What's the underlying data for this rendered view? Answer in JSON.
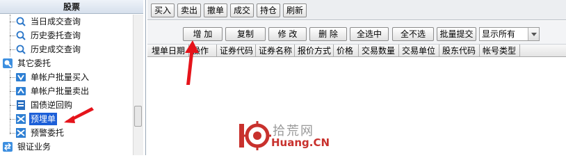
{
  "left_panel": {
    "header": "股票",
    "tree": [
      {
        "label": "当日成交查询",
        "icon": "search-doc-icon",
        "level": 2
      },
      {
        "label": "历史委托查询",
        "icon": "search-doc-icon",
        "level": 2
      },
      {
        "label": "历史成交查询",
        "icon": "search-doc-icon",
        "level": 2
      },
      {
        "label": "其它委托",
        "icon": "folder-search-icon",
        "level": 1
      },
      {
        "label": "单帐户批量买入",
        "icon": "batch-buy-icon",
        "level": 2
      },
      {
        "label": "单帐户批量卖出",
        "icon": "batch-sell-icon",
        "level": 2
      },
      {
        "label": "国债逆回购",
        "icon": "bond-icon",
        "level": 2
      },
      {
        "label": "预埋单",
        "icon": "preorder-icon",
        "level": 2,
        "selected": true
      },
      {
        "label": "预警委托",
        "icon": "alert-order-icon",
        "level": 2
      },
      {
        "label": "银证业务",
        "icon": "bank-transfer-icon",
        "level": 1
      }
    ]
  },
  "toolbar": {
    "buttons": [
      "买入",
      "卖出",
      "撤单",
      "成交",
      "持仓",
      "刷新"
    ]
  },
  "actionbar": {
    "buttons": [
      "增 加",
      "复制",
      "修 改",
      "删 除",
      "全选中",
      "全不选",
      "批量提交"
    ],
    "filter": {
      "value": "显示所有"
    }
  },
  "table": {
    "columns": [
      "埋单日期",
      "操作",
      "证券代码",
      "证券名称",
      "报价方式",
      "价格",
      "交易数量",
      "交易单位",
      "股东代码",
      "帐号类型"
    ],
    "rows": []
  },
  "watermark": {
    "logo_text": "10",
    "name_cn": "拾荒网",
    "name_en": "Huang.CN"
  },
  "colors": {
    "selection": "#1c5fd8",
    "arrow": "#e5141b",
    "watermark_red": "#c8312d"
  }
}
